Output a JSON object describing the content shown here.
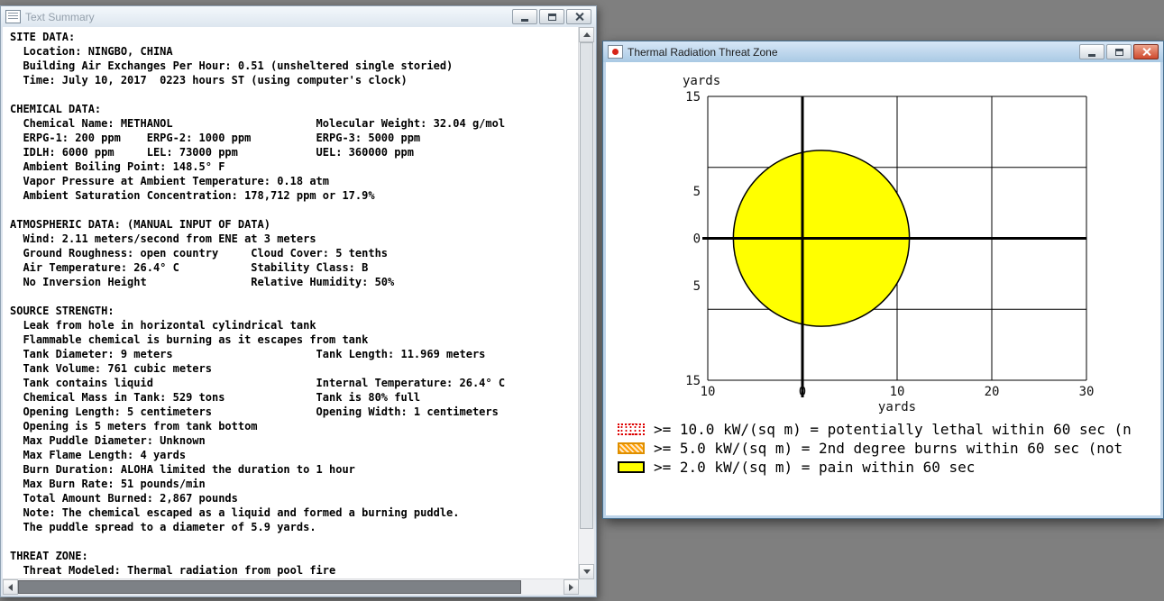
{
  "desktop": {
    "background": "#7f7f7f"
  },
  "text_summary_window": {
    "title": "Text Summary",
    "lines": [
      "SITE DATA:",
      "  Location: NINGBO, CHINA",
      "  Building Air Exchanges Per Hour: 0.51 (unsheltered single storied)",
      "  Time: July 10, 2017  0223 hours ST (using computer's clock)",
      "",
      "CHEMICAL DATA:",
      "  Chemical Name: METHANOL                      Molecular Weight: 32.04 g/mol",
      "  ERPG-1: 200 ppm    ERPG-2: 1000 ppm          ERPG-3: 5000 ppm",
      "  IDLH: 6000 ppm     LEL: 73000 ppm            UEL: 360000 ppm",
      "  Ambient Boiling Point: 148.5° F",
      "  Vapor Pressure at Ambient Temperature: 0.18 atm",
      "  Ambient Saturation Concentration: 178,712 ppm or 17.9%",
      "",
      "ATMOSPHERIC DATA: (MANUAL INPUT OF DATA)",
      "  Wind: 2.11 meters/second from ENE at 3 meters",
      "  Ground Roughness: open country     Cloud Cover: 5 tenths",
      "  Air Temperature: 26.4° C           Stability Class: B",
      "  No Inversion Height                Relative Humidity: 50%",
      "",
      "SOURCE STRENGTH:",
      "  Leak from hole in horizontal cylindrical tank",
      "  Flammable chemical is burning as it escapes from tank",
      "  Tank Diameter: 9 meters                      Tank Length: 11.969 meters",
      "  Tank Volume: 761 cubic meters",
      "  Tank contains liquid                         Internal Temperature: 26.4° C",
      "  Chemical Mass in Tank: 529 tons              Tank is 80% full",
      "  Opening Length: 5 centimeters                Opening Width: 1 centimeters",
      "  Opening is 5 meters from tank bottom",
      "  Max Puddle Diameter: Unknown",
      "  Max Flame Length: 4 yards",
      "  Burn Duration: ALOHA limited the duration to 1 hour",
      "  Max Burn Rate: 51 pounds/min",
      "  Total Amount Burned: 2,867 pounds",
      "  Note: The chemical escaped as a liquid and formed a burning puddle.",
      "  The puddle spread to a diameter of 5.9 yards.",
      "",
      "THREAT ZONE:",
      "  Threat Modeled: Thermal radiation from pool fire"
    ]
  },
  "threat_zone_window": {
    "title": "Thermal Radiation Threat Zone",
    "legend": [
      {
        "type": "red-dotted",
        "color": "#dd0000",
        "label": ">= 10.0 kW/(sq m) = potentially lethal within 60 sec (n"
      },
      {
        "type": "orange-hatched",
        "color": "#ff9d00",
        "label": ">= 5.0 kW/(sq m) = 2nd degree burns within 60 sec (not"
      },
      {
        "type": "yellow-solid",
        "color": "#ffff00",
        "label": ">= 2.0 kW/(sq m) = pain within 60 sec"
      }
    ]
  },
  "chart_data": {
    "type": "area",
    "title": "Thermal Radiation Threat Zone",
    "xlabel": "yards",
    "ylabel": "yards",
    "xlim": [
      -10,
      30
    ],
    "ylim": [
      -15,
      15
    ],
    "grid": true,
    "grid_x": [
      -10,
      0,
      10,
      20,
      30
    ],
    "grid_y": [
      15,
      7.5,
      -7.5,
      -15
    ],
    "xticks": [
      {
        "v": -10,
        "label": "10"
      },
      {
        "v": 0,
        "label": "0"
      },
      {
        "v": 10,
        "label": "10"
      },
      {
        "v": 20,
        "label": "20"
      },
      {
        "v": 30,
        "label": "30"
      }
    ],
    "yticks": [
      {
        "v": 15,
        "label": "15"
      },
      {
        "v": 5,
        "label": "5"
      },
      {
        "v": 0,
        "label": "0"
      },
      {
        "v": -5,
        "label": "5"
      },
      {
        "v": -15,
        "label": "15"
      }
    ],
    "axes_origin_bold": true,
    "zones": [
      {
        "threshold": ">= 10.0 kW/(sq m)",
        "effect": "potentially lethal within 60 sec",
        "drawn": false,
        "color": "#dd0000"
      },
      {
        "threshold": ">= 5.0 kW/(sq m)",
        "effect": "2nd degree burns within 60 sec",
        "drawn": false,
        "color": "#ff9d00"
      },
      {
        "threshold": ">= 2.0 kW/(sq m)",
        "effect": "pain within 60 sec",
        "drawn": true,
        "color": "#ffff00",
        "shape": "circle",
        "center_yards": [
          2,
          0
        ],
        "radius_yards": 9.3,
        "outline": "#000000"
      }
    ]
  }
}
